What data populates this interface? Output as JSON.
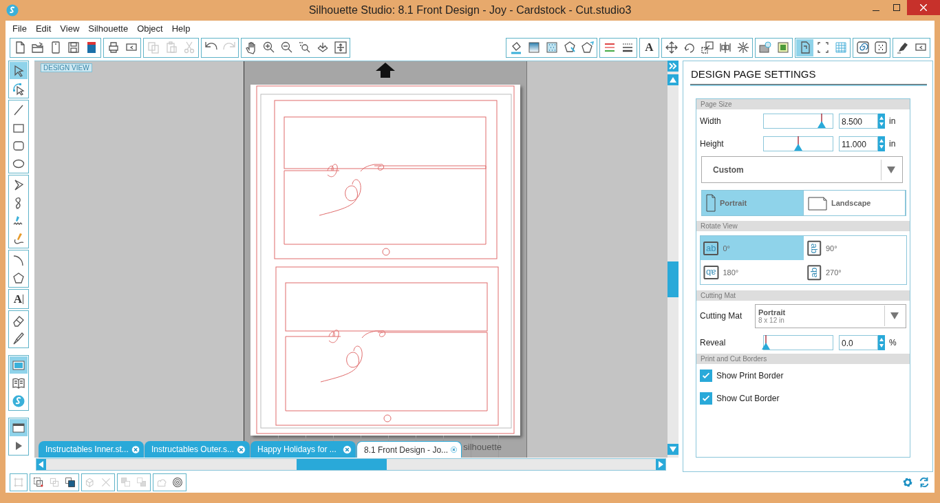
{
  "window": {
    "title": "Silhouette Studio: 8.1 Front Design - Joy - Cardstock - Cut.studio3"
  },
  "menu": [
    "File",
    "Edit",
    "View",
    "Silhouette",
    "Object",
    "Help"
  ],
  "toolbar_left": [
    {
      "items": [
        {
          "kind": "blank-page",
          "disabled": false
        },
        {
          "kind": "folder",
          "disabled": false
        },
        {
          "kind": "page-frame",
          "disabled": false
        },
        {
          "kind": "floppy-disk",
          "disabled": false
        },
        {
          "kind": "library-book",
          "disabled": false
        }
      ]
    },
    {
      "items": [
        {
          "kind": "printer",
          "disabled": false
        },
        {
          "kind": "plotter",
          "disabled": false
        }
      ]
    },
    {
      "items": [
        {
          "kind": "copy",
          "disabled": true
        },
        {
          "kind": "clipboard",
          "disabled": true
        },
        {
          "kind": "scissors",
          "disabled": true
        }
      ]
    },
    {
      "items": [
        {
          "kind": "undo",
          "disabled": false
        },
        {
          "kind": "redo",
          "disabled": true
        }
      ]
    },
    {
      "items": [
        {
          "kind": "hand",
          "disabled": false
        },
        {
          "kind": "zoom-in",
          "disabled": false
        },
        {
          "kind": "zoom-out",
          "disabled": false
        },
        {
          "kind": "zoom-box",
          "disabled": false
        },
        {
          "kind": "tray-arrow",
          "disabled": false
        },
        {
          "kind": "fit-frame",
          "disabled": false
        }
      ]
    }
  ],
  "toolbar_right": [
    {
      "items": [
        {
          "kind": "bucket"
        },
        {
          "kind": "gradient"
        },
        {
          "kind": "pattern"
        },
        {
          "kind": "star-pen"
        },
        {
          "kind": "pentagon-pen"
        }
      ]
    },
    {
      "items": [
        {
          "kind": "line-colors"
        },
        {
          "kind": "line-dashes"
        }
      ]
    },
    {
      "items": [
        {
          "kind": "letter",
          "glyph": "A"
        }
      ]
    },
    {
      "items": [
        {
          "kind": "move-arrows"
        },
        {
          "kind": "rotate"
        },
        {
          "kind": "scale"
        },
        {
          "kind": "align"
        },
        {
          "kind": "flower"
        }
      ]
    },
    {
      "items": [
        {
          "kind": "store"
        },
        {
          "kind": "trace"
        }
      ]
    },
    {
      "items": [
        {
          "kind": "page-rotate",
          "selected": true
        },
        {
          "kind": "crop-marks",
          "selected": false
        },
        {
          "kind": "grid",
          "selected": false
        }
      ]
    },
    {
      "items": [
        {
          "kind": "spiral"
        },
        {
          "kind": "dots"
        }
      ]
    },
    {
      "items": [
        {
          "kind": "marker"
        },
        {
          "kind": "plotter"
        }
      ]
    }
  ],
  "tools": [
    {
      "items": [
        {
          "kind": "pointer",
          "selected": true
        },
        {
          "kind": "node-pointer",
          "selected": false
        }
      ]
    },
    {
      "items": [
        {
          "kind": "line",
          "selected": false
        },
        {
          "kind": "rectangle",
          "selected": false
        },
        {
          "kind": "rounded-rectangle",
          "selected": false
        },
        {
          "kind": "ellipse",
          "selected": false
        }
      ]
    },
    {
      "items": [
        {
          "kind": "polygon-line",
          "selected": false
        },
        {
          "kind": "loop",
          "selected": false
        },
        {
          "kind": "squiggle-pen",
          "selected": false
        },
        {
          "kind": "pencil-curve",
          "selected": false
        }
      ]
    },
    {
      "items": [
        {
          "kind": "arc",
          "selected": false
        },
        {
          "kind": "pentagon",
          "selected": false
        }
      ]
    },
    {
      "items": [
        {
          "kind": "letter",
          "glyph": "A",
          "selected": false
        }
      ]
    },
    {
      "items": [
        {
          "kind": "eraser",
          "selected": false
        },
        {
          "kind": "knife",
          "selected": false
        }
      ]
    },
    {
      "items": [
        {
          "kind": "screen",
          "selected": true
        },
        {
          "kind": "book",
          "selected": false
        },
        {
          "kind": "logo",
          "selected": false
        }
      ]
    },
    {
      "items": [
        {
          "kind": "window",
          "selected": true
        },
        {
          "kind": "play",
          "selected": false
        }
      ]
    }
  ],
  "canvas": {
    "label": "DESIGN VIEW",
    "mat_brand": "silhouette"
  },
  "document_tabs": [
    {
      "label": "Instructables Inner.st...",
      "selected": false
    },
    {
      "label": "Instructables Outer.s...",
      "selected": false
    },
    {
      "label": "Happy Holidays for ...",
      "selected": false
    },
    {
      "label": "8.1 Front Design - Jo...",
      "selected": true
    }
  ],
  "bottom_toolbar": [
    {
      "items": [
        {
          "kind": "group-marks",
          "disabled": true
        }
      ]
    },
    {
      "items": [
        {
          "kind": "select-rect",
          "disabled": false
        },
        {
          "kind": "duplicate",
          "disabled": true
        },
        {
          "kind": "overlap",
          "disabled": false
        }
      ]
    },
    {
      "items": [
        {
          "kind": "weld",
          "disabled": true
        },
        {
          "kind": "cross",
          "disabled": true
        }
      ]
    },
    {
      "items": [
        {
          "kind": "stack",
          "disabled": true
        },
        {
          "kind": "stack-back",
          "disabled": true
        }
      ]
    },
    {
      "items": [
        {
          "kind": "cloud",
          "disabled": true
        },
        {
          "kind": "target",
          "disabled": false
        }
      ]
    }
  ],
  "panel": {
    "title": "DESIGN PAGE SETTINGS",
    "page_size": {
      "header": "Page Size",
      "fields": [
        {
          "label": "Width",
          "level": 0.84,
          "value": "8.500",
          "unit": "in"
        },
        {
          "label": "Height",
          "level": 0.5,
          "value": "11.000",
          "unit": "in"
        }
      ],
      "preset": "Custom",
      "orientations": [
        {
          "label": "Portrait",
          "kind": "portrait",
          "selected": true
        },
        {
          "label": "Landscape",
          "kind": "landscape",
          "selected": false
        }
      ]
    },
    "rotate_view": {
      "header": "Rotate View",
      "options": [
        {
          "label": "0°",
          "glyph": "ab",
          "kind": "upright",
          "selected": true
        },
        {
          "label": "90°",
          "glyph": "ab",
          "kind": "right",
          "selected": false
        },
        {
          "label": "180°",
          "glyph": "ab",
          "kind": "inverted",
          "selected": false
        },
        {
          "label": "270°",
          "glyph": "ab",
          "kind": "left",
          "selected": false
        }
      ]
    },
    "cutting_mat": {
      "header": "Cutting Mat",
      "label": "Cutting Mat",
      "value": "Portrait",
      "detail": "8 x 12 in",
      "reveal": {
        "label": "Reveal",
        "level": 0.03,
        "value": "0.0",
        "unit": "%"
      }
    },
    "borders": {
      "header": "Print and Cut Borders",
      "options": [
        {
          "label": "Show Print Border",
          "checked": true
        },
        {
          "label": "Show Cut Border",
          "checked": true
        }
      ]
    }
  }
}
